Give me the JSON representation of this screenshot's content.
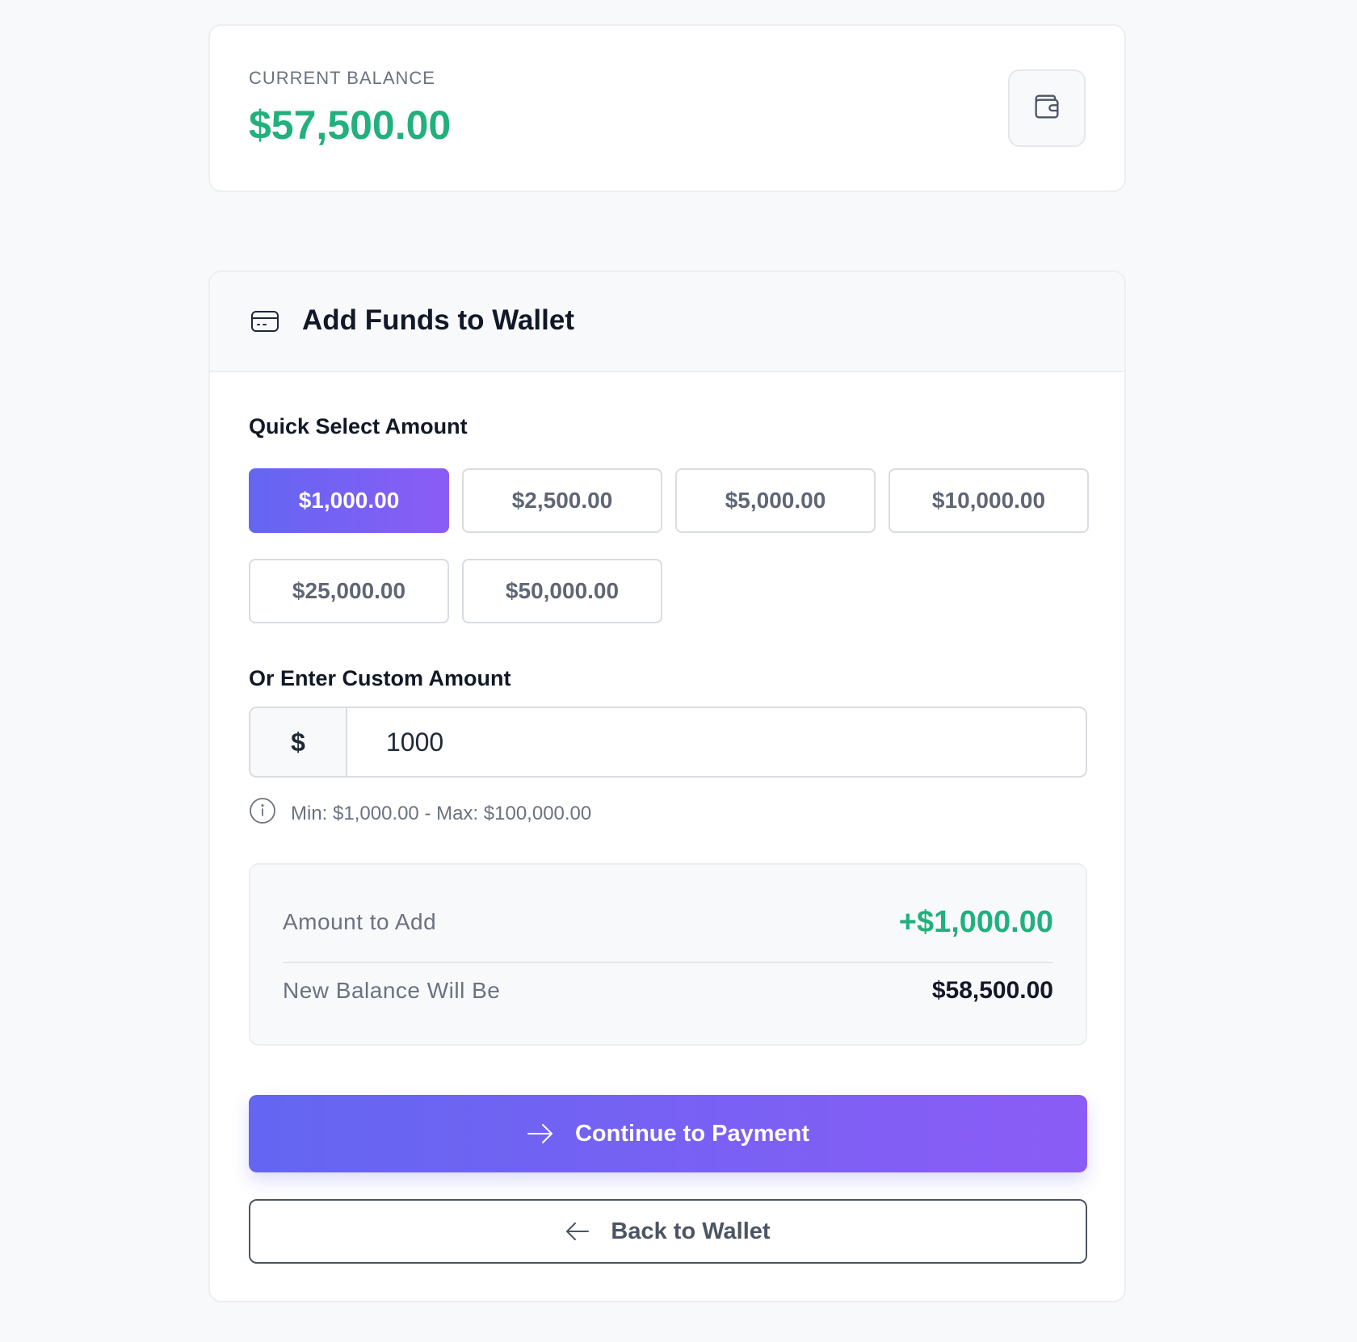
{
  "balance": {
    "label": "CURRENT BALANCE",
    "amount": "$57,500.00",
    "wallet_icon": "wallet-icon"
  },
  "funds": {
    "title": "Add Funds to Wallet",
    "title_icon": "credit-card-icon",
    "quick_select_label": "Quick Select Amount",
    "quick_amounts": [
      {
        "label": "$1,000.00",
        "selected": true
      },
      {
        "label": "$2,500.00",
        "selected": false
      },
      {
        "label": "$5,000.00",
        "selected": false
      },
      {
        "label": "$10,000.00",
        "selected": false
      },
      {
        "label": "$25,000.00",
        "selected": false
      },
      {
        "label": "$50,000.00",
        "selected": false
      }
    ],
    "custom_label": "Or Enter Custom Amount",
    "currency_symbol": "$",
    "custom_value": "1000",
    "hint": "Min: $1,000.00 - Max: $100,000.00",
    "hint_icon": "info-icon"
  },
  "summary": {
    "amount_label": "Amount to Add",
    "amount_value": "+$1,000.00",
    "new_balance_label": "New Balance Will Be",
    "new_balance_value": "$58,500.00"
  },
  "actions": {
    "continue_label": "Continue to Payment",
    "continue_icon": "arrow-right-icon",
    "back_label": "Back to Wallet",
    "back_icon": "arrow-left-icon"
  },
  "colors": {
    "accent_start": "#6366f1",
    "accent_end": "#8b5cf6",
    "positive": "#22b07d",
    "background": "#f8f9fb"
  }
}
